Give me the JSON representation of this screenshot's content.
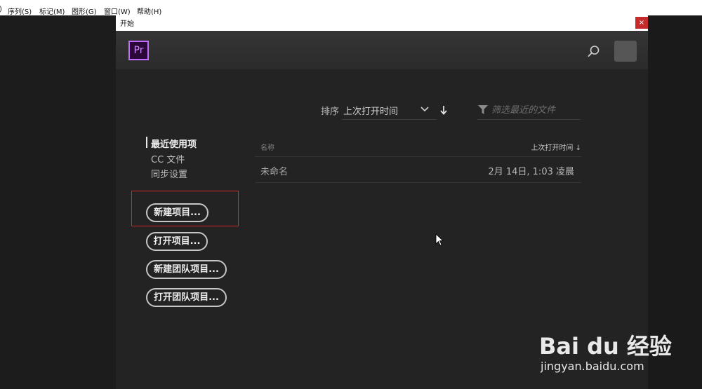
{
  "menubar": {
    "items": [
      "序列(S)",
      "标记(M)",
      "图形(G)",
      "窗口(W)",
      "帮助(H)"
    ]
  },
  "dialog": {
    "title": "开始",
    "close_glyph": "×",
    "logo_text": "Pr"
  },
  "sort": {
    "label": "排序",
    "value": "上次打开时间"
  },
  "filter": {
    "placeholder": "筛选最近的文件"
  },
  "nav": {
    "items": [
      {
        "label": "最近使用项",
        "active": true
      },
      {
        "label": "CC 文件",
        "active": false
      },
      {
        "label": "同步设置",
        "active": false
      }
    ]
  },
  "buttons": {
    "new_project": "新建项目...",
    "open_project": "打开项目...",
    "new_team_project": "新建团队项目...",
    "open_team_project": "打开团队项目..."
  },
  "table": {
    "col_name": "名称",
    "col_time": "上次打开时间 ↓",
    "rows": [
      {
        "name": "未命名",
        "time": "2月 14日, 1:03 凌晨"
      }
    ]
  },
  "watermark": {
    "text": "Bai du 经验",
    "url": "jingyan.baidu.com"
  },
  "colors": {
    "accent_pr": "#c36bff",
    "highlight_border": "#d4272a",
    "close_button": "#c62b2b"
  },
  "icons": [
    "search-icon",
    "chevron-down-icon",
    "sort-arrow-icon",
    "filter-icon",
    "mouse-cursor-icon"
  ]
}
